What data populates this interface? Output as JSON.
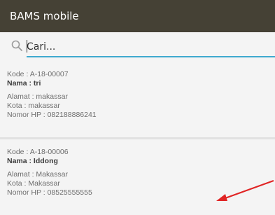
{
  "app": {
    "title": "BAMS mobile"
  },
  "search": {
    "value": "Cari..."
  },
  "contacts": [
    {
      "kode": "Kode : A-18-00007",
      "nama": "Nama : tri",
      "alamat": "Alamat : makassar",
      "kota": "Kota : makassar",
      "nomor_hp": "Nomor HP : 082188886241"
    },
    {
      "kode": "Kode : A-18-00006",
      "nama": "Nama : Iddong",
      "alamat": "Alamat : Makassar",
      "kota": "Kota : Makassar",
      "nomor_hp": "Nomor HP : 08525555555"
    }
  ],
  "annotation": {
    "arrow_color": "#e02424"
  },
  "colors": {
    "appbar": "#454135",
    "accent": "#3fa9cf"
  }
}
